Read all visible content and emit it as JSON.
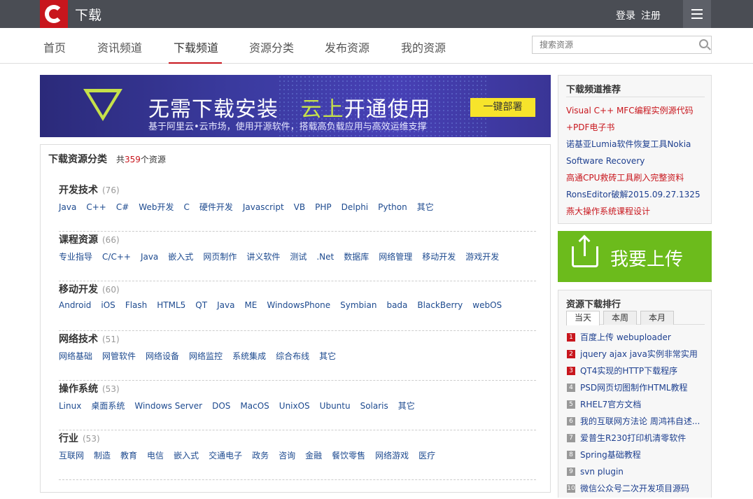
{
  "header": {
    "logo_letter": "C",
    "site_title": "下载",
    "login": "登录",
    "register": "注册"
  },
  "nav": {
    "items": [
      "首页",
      "资讯频道",
      "下载频道",
      "资源分类",
      "发布资源",
      "我的资源"
    ],
    "active": "下载频道",
    "search_placeholder": "搜索资源"
  },
  "banner": {
    "headline_a": "无需下载安装",
    "headline_hl": "云上",
    "headline_b": "开通使用",
    "subline": "基于阿里云•云市场，使用开源软件，搭载高负载应用与高效运维支撑",
    "button": "一键部署"
  },
  "categories": {
    "title": "下载资源分类",
    "count_prefix": "共",
    "count": "359",
    "count_suffix": "个资源",
    "groups": [
      {
        "name": "开发技术",
        "count": "(76)",
        "links": [
          "Java",
          "C++",
          "C#",
          "Web开发",
          "C",
          "硬件开发",
          "Javascript",
          "VB",
          "PHP",
          "Delphi",
          "Python",
          "其它"
        ]
      },
      {
        "name": "课程资源",
        "count": "(66)",
        "links": [
          "专业指导",
          "C/C++",
          "Java",
          "嵌入式",
          "网页制作",
          "讲义软件",
          "测试",
          ".Net",
          "数据库",
          "网络管理",
          "移动开发",
          "游戏开发"
        ]
      },
      {
        "name": "移动开发",
        "count": "(60)",
        "links": [
          "Android",
          "iOS",
          "Flash",
          "HTML5",
          "QT",
          "Java",
          "ME",
          "WindowsPhone",
          "Symbian",
          "bada",
          "BlackBerry",
          "webOS"
        ]
      },
      {
        "name": "网络技术",
        "count": "(51)",
        "links": [
          "网络基础",
          "网管软件",
          "网络设备",
          "网络监控",
          "系统集成",
          "综合布线",
          "其它"
        ]
      },
      {
        "name": "操作系统",
        "count": "(53)",
        "links": [
          "Linux",
          "桌面系统",
          "Windows Server",
          "DOS",
          "MacOS",
          "UnixOS",
          "Ubuntu",
          "Solaris",
          "其它"
        ]
      },
      {
        "name": "行业",
        "count": "(53)",
        "links": [
          "互联网",
          "制造",
          "教育",
          "电信",
          "嵌入式",
          "交通电子",
          "政务",
          "咨询",
          "金融",
          "餐饮零售",
          "网络游戏",
          "医疗"
        ]
      }
    ]
  },
  "recommend": {
    "title": "下载频道推荐",
    "items": [
      {
        "text": "Visual C++ MFC编程实例源代码",
        "color": "red"
      },
      {
        "text": "+PDF电子书",
        "color": "red"
      },
      {
        "text": "诺基亚Lumia软件恢复工具Nokia",
        "color": "blue"
      },
      {
        "text": "Software Recovery",
        "color": "blue"
      },
      {
        "text": "高通CPU救砖工具刷入完整资料",
        "color": "red"
      },
      {
        "text": "RonsEditor破解2015.09.27.1325",
        "color": "blue"
      },
      {
        "text": "燕大操作系统课程设计",
        "color": "red"
      }
    ]
  },
  "upload": {
    "label": "我要上传"
  },
  "ranking": {
    "title": "资源下载排行",
    "tabs": [
      "当天",
      "本周",
      "本月"
    ],
    "active_tab": "当天",
    "items": [
      {
        "rank": "1",
        "title": "百度上传 webuploader"
      },
      {
        "rank": "2",
        "title": "jquery ajax java实例非常实用"
      },
      {
        "rank": "3",
        "title": "QT4实现的HTTP下载程序"
      },
      {
        "rank": "4",
        "title": "PSD网页切图制作HTML教程"
      },
      {
        "rank": "5",
        "title": "RHEL7官方文档"
      },
      {
        "rank": "6",
        "title": "我的互联网方法论 周鸿祎自述..."
      },
      {
        "rank": "7",
        "title": "爱普生R230打印机清零软件"
      },
      {
        "rank": "8",
        "title": "Spring基础教程"
      },
      {
        "rank": "9",
        "title": "svn plugin"
      },
      {
        "rank": "10",
        "title": "微信公众号二次开发项目源码"
      }
    ]
  },
  "colors": {
    "brand": "#c8161d",
    "link": "#1d4a8f",
    "upload": "#6cbb1c",
    "topbar": "#4a4d54"
  }
}
